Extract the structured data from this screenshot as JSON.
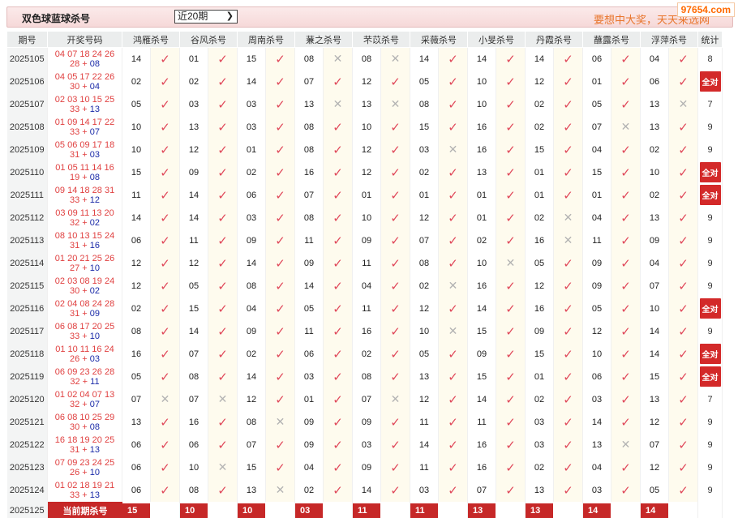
{
  "header": {
    "title": "双色球蓝球杀号",
    "period_select": "近20期",
    "slogan": "要想中大奖，天天来选网",
    "watermark": "97654.com"
  },
  "columns": [
    "期号",
    "开奖号码",
    "鸿雁杀号",
    "谷风杀号",
    "周南杀号",
    "蒹之杀号",
    "芣苡杀号",
    "采薇杀号",
    "小旻杀号",
    "丹霞杀号",
    "蘸露杀号",
    "浮萍杀号",
    "统计"
  ],
  "all_correct_label": "全对",
  "rows": [
    {
      "issue": "2025105",
      "red": "04 07 18 24 26 28",
      "blue": "08",
      "kills": [
        [
          "14",
          1
        ],
        [
          "01",
          1
        ],
        [
          "15",
          1
        ],
        [
          "08",
          0
        ],
        [
          "08",
          0
        ],
        [
          "14",
          1
        ],
        [
          "14",
          1
        ],
        [
          "14",
          1
        ],
        [
          "06",
          1
        ],
        [
          "04",
          1
        ]
      ],
      "stat": "8"
    },
    {
      "issue": "2025106",
      "red": "04 05 17 22 26 30",
      "blue": "04",
      "kills": [
        [
          "02",
          1
        ],
        [
          "02",
          1
        ],
        [
          "14",
          1
        ],
        [
          "07",
          1
        ],
        [
          "12",
          1
        ],
        [
          "05",
          1
        ],
        [
          "10",
          1
        ],
        [
          "12",
          1
        ],
        [
          "01",
          1
        ],
        [
          "06",
          1
        ]
      ],
      "stat": "全对"
    },
    {
      "issue": "2025107",
      "red": "02 03 10 15 25 33",
      "blue": "13",
      "kills": [
        [
          "05",
          1
        ],
        [
          "03",
          1
        ],
        [
          "03",
          1
        ],
        [
          "13",
          0
        ],
        [
          "13",
          0
        ],
        [
          "08",
          1
        ],
        [
          "10",
          1
        ],
        [
          "02",
          1
        ],
        [
          "05",
          1
        ],
        [
          "13",
          0
        ]
      ],
      "stat": "7"
    },
    {
      "issue": "2025108",
      "red": "01 09 14 17 22 33",
      "blue": "07",
      "kills": [
        [
          "10",
          1
        ],
        [
          "13",
          1
        ],
        [
          "03",
          1
        ],
        [
          "08",
          1
        ],
        [
          "10",
          1
        ],
        [
          "15",
          1
        ],
        [
          "16",
          1
        ],
        [
          "02",
          1
        ],
        [
          "07",
          0
        ],
        [
          "13",
          1
        ]
      ],
      "stat": "9"
    },
    {
      "issue": "2025109",
      "red": "05 06 09 17 18 31",
      "blue": "03",
      "kills": [
        [
          "10",
          1
        ],
        [
          "12",
          1
        ],
        [
          "01",
          1
        ],
        [
          "08",
          1
        ],
        [
          "12",
          1
        ],
        [
          "03",
          0
        ],
        [
          "16",
          1
        ],
        [
          "15",
          1
        ],
        [
          "04",
          1
        ],
        [
          "02",
          1
        ]
      ],
      "stat": "9"
    },
    {
      "issue": "2025110",
      "red": "01 05 11 14 16 19",
      "blue": "08",
      "kills": [
        [
          "15",
          1
        ],
        [
          "09",
          1
        ],
        [
          "02",
          1
        ],
        [
          "16",
          1
        ],
        [
          "12",
          1
        ],
        [
          "02",
          1
        ],
        [
          "13",
          1
        ],
        [
          "01",
          1
        ],
        [
          "15",
          1
        ],
        [
          "10",
          1
        ]
      ],
      "stat": "全对"
    },
    {
      "issue": "2025111",
      "red": "09 14 18 28 31 33",
      "blue": "12",
      "kills": [
        [
          "11",
          1
        ],
        [
          "14",
          1
        ],
        [
          "06",
          1
        ],
        [
          "07",
          1
        ],
        [
          "01",
          1
        ],
        [
          "01",
          1
        ],
        [
          "01",
          1
        ],
        [
          "01",
          1
        ],
        [
          "01",
          1
        ],
        [
          "02",
          1
        ]
      ],
      "stat": "全对"
    },
    {
      "issue": "2025112",
      "red": "03 09 11 13 20 32",
      "blue": "02",
      "kills": [
        [
          "14",
          1
        ],
        [
          "14",
          1
        ],
        [
          "03",
          1
        ],
        [
          "08",
          1
        ],
        [
          "10",
          1
        ],
        [
          "12",
          1
        ],
        [
          "01",
          1
        ],
        [
          "02",
          0
        ],
        [
          "04",
          1
        ],
        [
          "13",
          1
        ]
      ],
      "stat": "9"
    },
    {
      "issue": "2025113",
      "red": "08 10 13 15 24 31",
      "blue": "16",
      "kills": [
        [
          "06",
          1
        ],
        [
          "11",
          1
        ],
        [
          "09",
          1
        ],
        [
          "11",
          1
        ],
        [
          "09",
          1
        ],
        [
          "07",
          1
        ],
        [
          "02",
          1
        ],
        [
          "16",
          0
        ],
        [
          "11",
          1
        ],
        [
          "09",
          1
        ]
      ],
      "stat": "9"
    },
    {
      "issue": "2025114",
      "red": "01 20 21 25 26 27",
      "blue": "10",
      "kills": [
        [
          "12",
          1
        ],
        [
          "12",
          1
        ],
        [
          "14",
          1
        ],
        [
          "09",
          1
        ],
        [
          "11",
          1
        ],
        [
          "08",
          1
        ],
        [
          "10",
          0
        ],
        [
          "05",
          1
        ],
        [
          "09",
          1
        ],
        [
          "04",
          1
        ]
      ],
      "stat": "9"
    },
    {
      "issue": "2025115",
      "red": "02 03 08 19 24 30",
      "blue": "02",
      "kills": [
        [
          "12",
          1
        ],
        [
          "05",
          1
        ],
        [
          "08",
          1
        ],
        [
          "14",
          1
        ],
        [
          "04",
          1
        ],
        [
          "02",
          0
        ],
        [
          "16",
          1
        ],
        [
          "12",
          1
        ],
        [
          "09",
          1
        ],
        [
          "07",
          1
        ]
      ],
      "stat": "9"
    },
    {
      "issue": "2025116",
      "red": "02 04 08 24 28 31",
      "blue": "09",
      "kills": [
        [
          "02",
          1
        ],
        [
          "15",
          1
        ],
        [
          "04",
          1
        ],
        [
          "05",
          1
        ],
        [
          "11",
          1
        ],
        [
          "12",
          1
        ],
        [
          "14",
          1
        ],
        [
          "16",
          1
        ],
        [
          "05",
          1
        ],
        [
          "10",
          1
        ]
      ],
      "stat": "全对"
    },
    {
      "issue": "2025117",
      "red": "06 08 17 20 25 33",
      "blue": "10",
      "kills": [
        [
          "08",
          1
        ],
        [
          "14",
          1
        ],
        [
          "09",
          1
        ],
        [
          "11",
          1
        ],
        [
          "16",
          1
        ],
        [
          "10",
          0
        ],
        [
          "15",
          1
        ],
        [
          "09",
          1
        ],
        [
          "12",
          1
        ],
        [
          "14",
          1
        ]
      ],
      "stat": "9"
    },
    {
      "issue": "2025118",
      "red": "01 10 11 16 24 26",
      "blue": "03",
      "kills": [
        [
          "16",
          1
        ],
        [
          "07",
          1
        ],
        [
          "02",
          1
        ],
        [
          "06",
          1
        ],
        [
          "02",
          1
        ],
        [
          "05",
          1
        ],
        [
          "09",
          1
        ],
        [
          "15",
          1
        ],
        [
          "10",
          1
        ],
        [
          "14",
          1
        ]
      ],
      "stat": "全对"
    },
    {
      "issue": "2025119",
      "red": "06 09 23 26 28 32",
      "blue": "11",
      "kills": [
        [
          "05",
          1
        ],
        [
          "08",
          1
        ],
        [
          "14",
          1
        ],
        [
          "03",
          1
        ],
        [
          "08",
          1
        ],
        [
          "13",
          1
        ],
        [
          "15",
          1
        ],
        [
          "01",
          1
        ],
        [
          "06",
          1
        ],
        [
          "15",
          1
        ]
      ],
      "stat": "全对"
    },
    {
      "issue": "2025120",
      "red": "01 02 04 07 13 32",
      "blue": "07",
      "kills": [
        [
          "07",
          0
        ],
        [
          "07",
          0
        ],
        [
          "12",
          1
        ],
        [
          "01",
          1
        ],
        [
          "07",
          0
        ],
        [
          "12",
          1
        ],
        [
          "14",
          1
        ],
        [
          "02",
          1
        ],
        [
          "03",
          1
        ],
        [
          "13",
          1
        ]
      ],
      "stat": "7"
    },
    {
      "issue": "2025121",
      "red": "06 08 10 25 29 30",
      "blue": "08",
      "kills": [
        [
          "13",
          1
        ],
        [
          "16",
          1
        ],
        [
          "08",
          0
        ],
        [
          "09",
          1
        ],
        [
          "09",
          1
        ],
        [
          "11",
          1
        ],
        [
          "11",
          1
        ],
        [
          "03",
          1
        ],
        [
          "14",
          1
        ],
        [
          "12",
          1
        ]
      ],
      "stat": "9"
    },
    {
      "issue": "2025122",
      "red": "16 18 19 20 25 31",
      "blue": "13",
      "kills": [
        [
          "06",
          1
        ],
        [
          "06",
          1
        ],
        [
          "07",
          1
        ],
        [
          "09",
          1
        ],
        [
          "03",
          1
        ],
        [
          "14",
          1
        ],
        [
          "16",
          1
        ],
        [
          "03",
          1
        ],
        [
          "13",
          0
        ],
        [
          "07",
          1
        ]
      ],
      "stat": "9"
    },
    {
      "issue": "2025123",
      "red": "07 09 23 24 25 26",
      "blue": "10",
      "kills": [
        [
          "06",
          1
        ],
        [
          "10",
          0
        ],
        [
          "15",
          1
        ],
        [
          "04",
          1
        ],
        [
          "09",
          1
        ],
        [
          "11",
          1
        ],
        [
          "16",
          1
        ],
        [
          "02",
          1
        ],
        [
          "04",
          1
        ],
        [
          "12",
          1
        ]
      ],
      "stat": "9"
    },
    {
      "issue": "2025124",
      "red": "01 02 18 19 21 33",
      "blue": "13",
      "kills": [
        [
          "06",
          1
        ],
        [
          "08",
          1
        ],
        [
          "13",
          0
        ],
        [
          "02",
          1
        ],
        [
          "14",
          1
        ],
        [
          "03",
          1
        ],
        [
          "07",
          1
        ],
        [
          "13",
          1
        ],
        [
          "03",
          1
        ],
        [
          "05",
          1
        ]
      ],
      "stat": "9"
    }
  ],
  "current": {
    "issue": "2025125",
    "label": "当前期杀号",
    "values": [
      "15",
      "10",
      "10",
      "03",
      "11",
      "11",
      "13",
      "13",
      "14",
      "14"
    ]
  },
  "colors": {
    "hit": "#e0485a",
    "miss": "#b3b3b3",
    "badge": "#c62828",
    "blue_ball": "#1a2aa8",
    "red_ball": "#e04040"
  },
  "icons": {
    "hit": "check-icon",
    "miss": "cross-icon"
  }
}
